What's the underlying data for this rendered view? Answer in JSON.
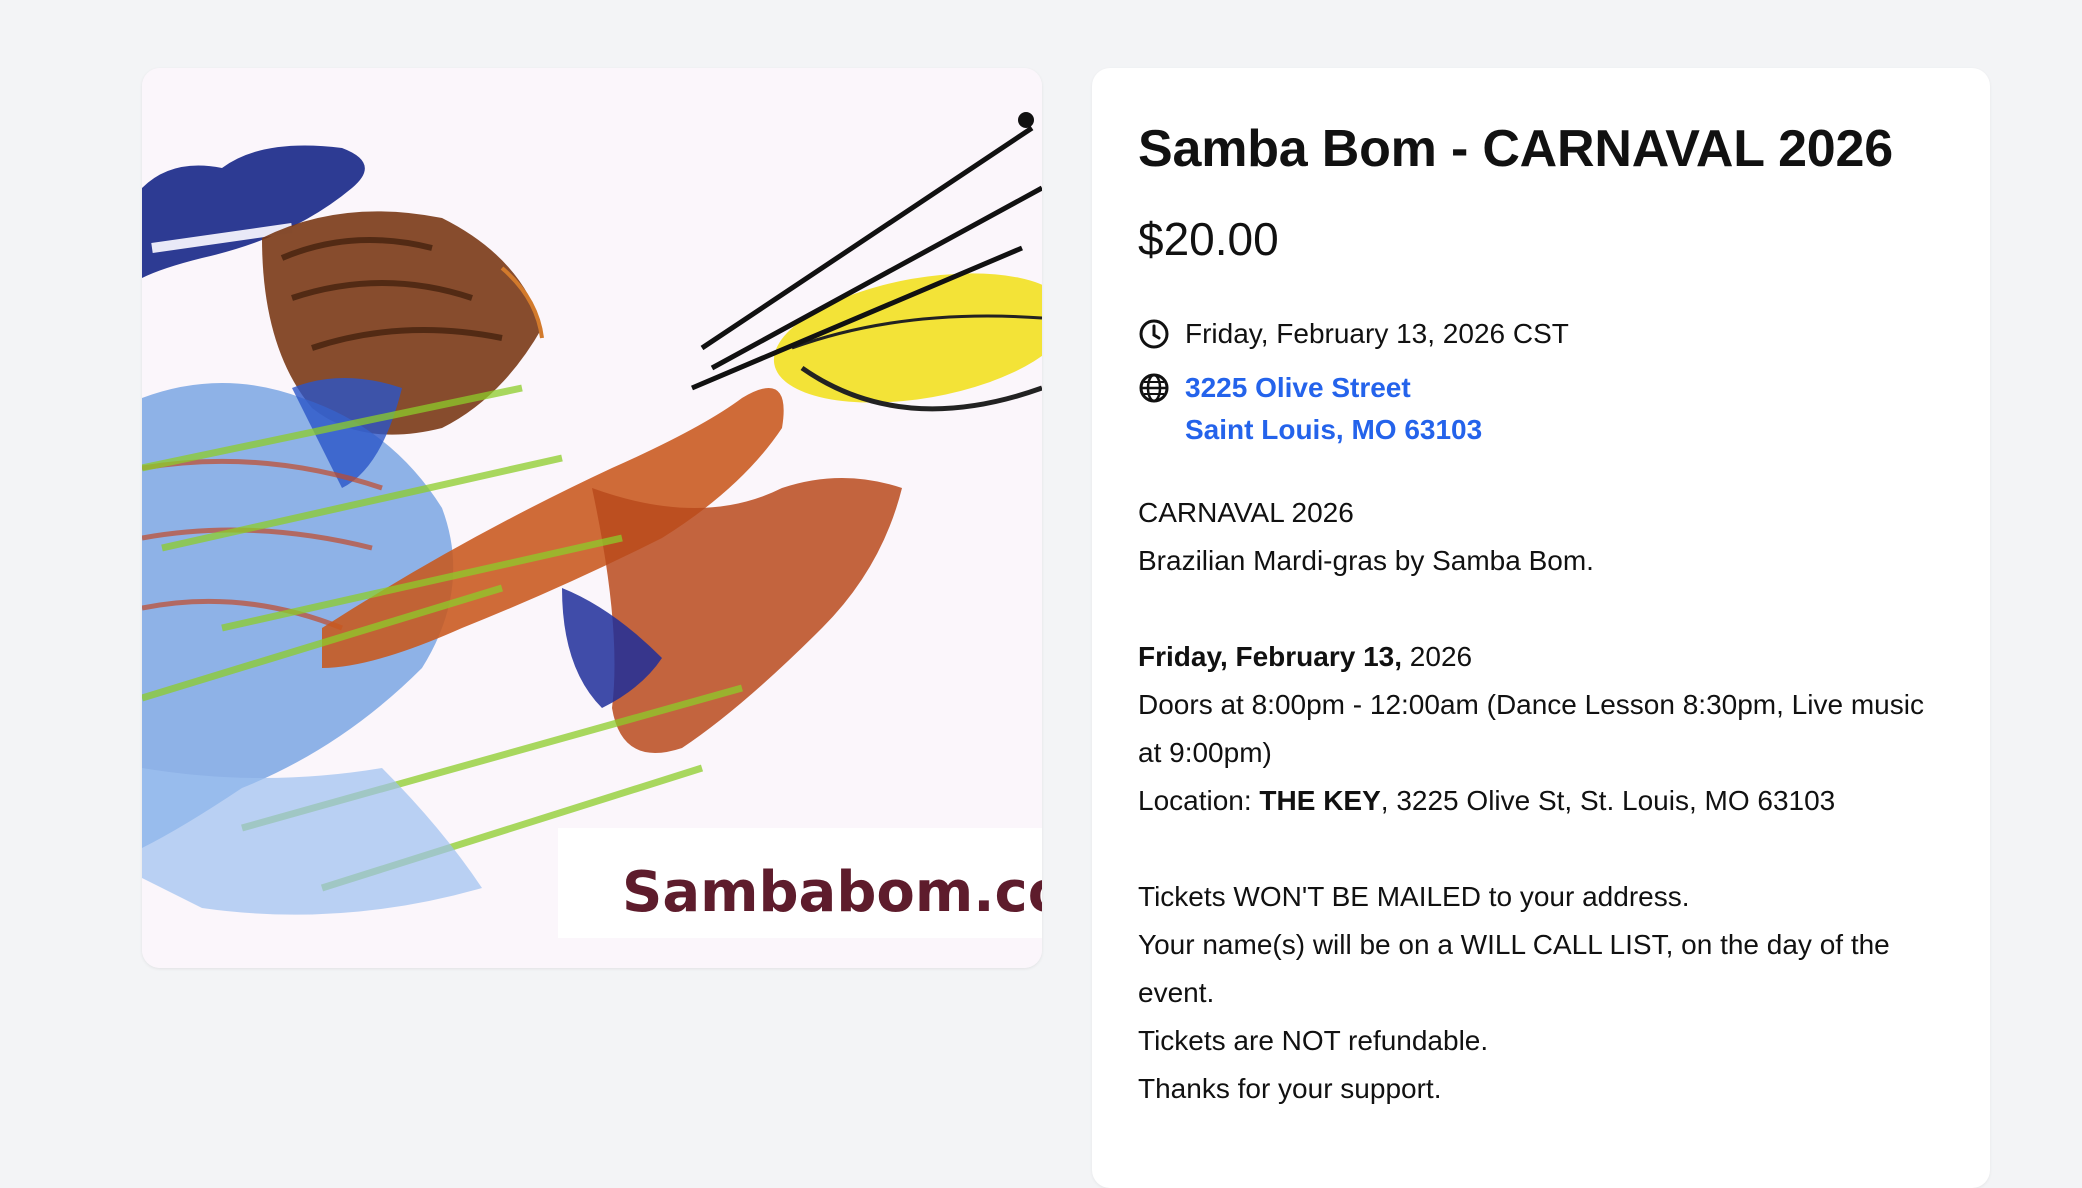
{
  "event": {
    "title": "Samba Bom - CARNAVAL 2026",
    "price": "$20.00",
    "date": "Friday, February 13, 2026 CST",
    "address_line1": "3225 Olive Street",
    "address_line2": "Saint Louis, MO 63103"
  },
  "image": {
    "logo_text": "Sambabom.co"
  },
  "description": {
    "line1": "CARNAVAL 2026",
    "line2": "Brazilian Mardi-gras by Samba Bom.",
    "date_bold": "Friday, February 13,",
    "date_year": " 2026",
    "doors": "Doors at 8:00pm - 12:00am (Dance Lesson 8:30pm, Live music at 9:00pm)",
    "location_label": "Location: ",
    "location_venue": "THE KEY",
    "location_address": ", 3225 Olive St, St. Louis, MO 63103",
    "notice1": "Tickets WON'T BE MAILED to your address.",
    "notice2": "Your name(s) will be on a WILL CALL LIST, on the day of the event.",
    "notice3": "Tickets are NOT refundable.",
    "notice4": "Thanks for your support."
  },
  "icons": {
    "date": "clock-icon",
    "location": "globe-icon"
  }
}
